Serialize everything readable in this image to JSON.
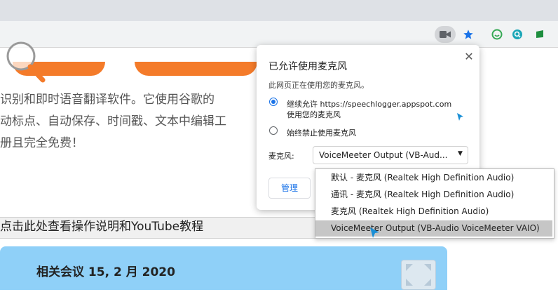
{
  "browser": {
    "icons": [
      "camera-icon",
      "star-icon",
      "extension-icon",
      "extension-icon",
      "extension-icon"
    ],
    "colors": {
      "star": "#1a73e8",
      "ext_green": "#34a853",
      "ext_teal": "#1aa6b7"
    }
  },
  "page": {
    "paragraph_lines": [
      "识别和即时语音翻译软件。它使用谷歌的",
      "动标点、自动保存、时间戳、文本中编辑工",
      "册且完全免费！"
    ],
    "instructions_link": "点击此处查看操作说明和YouTube教程",
    "meeting_title": "相关会议 15, 2 月 2020",
    "colors": {
      "accent_orange": "#f47b2a",
      "card_blue": "#8fd0f8"
    }
  },
  "popup": {
    "title": "已允许使用麦克风",
    "subtitle": "此网页正在使用您的麦克风。",
    "allow_option_line1": "继续允许 https://speechlogger.appspot.com",
    "allow_option_line2": "使用您的麦克风",
    "block_option": "始终禁止使用麦克风",
    "selected_option": "allow",
    "mic_label": "麦克风:",
    "mic_selected": "VoiceMeeter Output (VB-Aud...",
    "manage_button": "管理",
    "close_icon": "close-icon"
  },
  "mic_dropdown": {
    "options": [
      "默认 - 麦克风 (Realtek High Definition Audio)",
      "通讯 - 麦克风 (Realtek High Definition Audio)",
      "麦克风 (Realtek High Definition Audio)",
      "VoiceMeeter Output (VB-Audio VoiceMeeter VAIO)"
    ],
    "highlighted_index": 3
  }
}
